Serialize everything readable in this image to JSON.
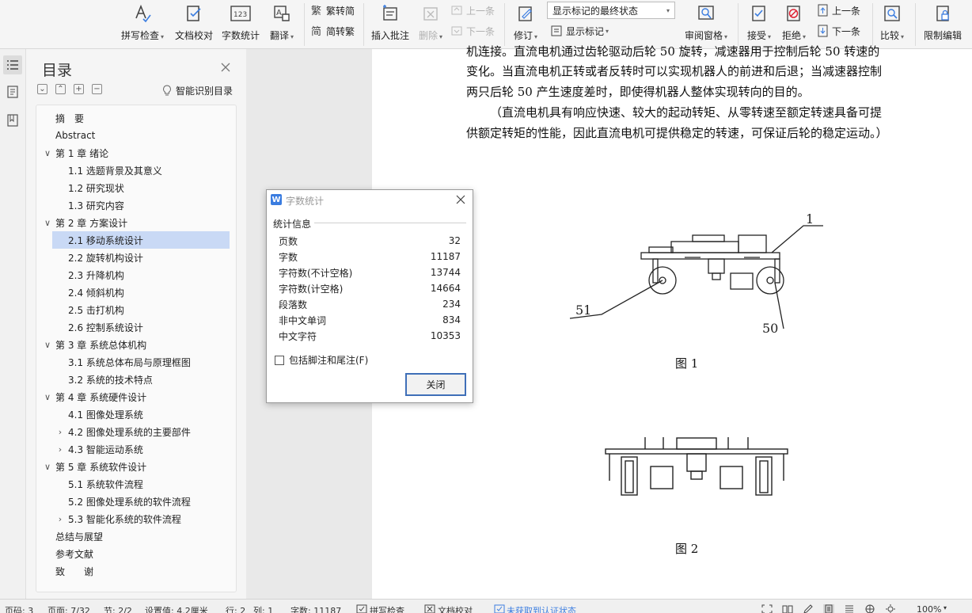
{
  "ribbon": {
    "spell_check": "拼写检查",
    "doc_proof": "文档校对",
    "word_count": "字数统计",
    "translate": "翻译",
    "trad_to_simp": "繁转简",
    "simp_to_trad": "简转繁",
    "insert_comment": "插入批注",
    "delete": "删除",
    "prev_comment": "上一条",
    "next_comment": "下一条",
    "revise": "修订",
    "markup_mode": "显示标记的最终状态",
    "show_markup": "显示标记",
    "review_pane": "审阅窗格",
    "accept": "接受",
    "reject": "拒绝",
    "prev_change": "上一条",
    "next_change": "下一条",
    "compare": "比较",
    "restrict_edit": "限制编辑"
  },
  "toc": {
    "title": "目录",
    "smart_label": "智能识别目录",
    "items": [
      {
        "label": "摘　要",
        "level": 1,
        "chevron": ""
      },
      {
        "label": "Abstract",
        "level": 1,
        "chevron": ""
      },
      {
        "label": "第 1 章  绪论",
        "level": 1,
        "chevron": "∨"
      },
      {
        "label": "1.1 选题背景及其意义",
        "level": 2,
        "chevron": ""
      },
      {
        "label": "1.2 研究现状",
        "level": 2,
        "chevron": ""
      },
      {
        "label": "1.3 研究内容",
        "level": 2,
        "chevron": ""
      },
      {
        "label": "第 2 章  方案设计",
        "level": 1,
        "chevron": "∨"
      },
      {
        "label": "2.1  移动系统设计",
        "level": 2,
        "chevron": "",
        "selected": true
      },
      {
        "label": "2.2 旋转机构设计",
        "level": 2,
        "chevron": ""
      },
      {
        "label": "2.3 升降机构",
        "level": 2,
        "chevron": ""
      },
      {
        "label": "2.4 倾斜机构",
        "level": 2,
        "chevron": ""
      },
      {
        "label": "2.5 击打机构",
        "level": 2,
        "chevron": ""
      },
      {
        "label": "2.6 控制系统设计",
        "level": 2,
        "chevron": ""
      },
      {
        "label": "第 3 章  系统总体机构",
        "level": 1,
        "chevron": "∨"
      },
      {
        "label": "3.1 系统总体布局与原理框图",
        "level": 2,
        "chevron": ""
      },
      {
        "label": "3.2 系统的技术特点",
        "level": 2,
        "chevron": ""
      },
      {
        "label": "第 4 章  系统硬件设计",
        "level": 1,
        "chevron": "∨"
      },
      {
        "label": "4.1 图像处理系统",
        "level": 2,
        "chevron": ""
      },
      {
        "label": "4.2  图像处理系统的主要部件",
        "level": 2,
        "chevron": "›"
      },
      {
        "label": "4.3 智能运动系统",
        "level": 2,
        "chevron": "›"
      },
      {
        "label": "第 5 章  系统软件设计",
        "level": 1,
        "chevron": "∨"
      },
      {
        "label": "5.1 系统软件流程",
        "level": 2,
        "chevron": ""
      },
      {
        "label": "5.2 图像处理系统的软件流程",
        "level": 2,
        "chevron": ""
      },
      {
        "label": "5.3 智能化系统的软件流程",
        "level": 2,
        "chevron": "›"
      },
      {
        "label": "总结与展望",
        "level": 1,
        "chevron": ""
      },
      {
        "label": "参考文献",
        "level": 1,
        "chevron": ""
      },
      {
        "label": "致　　谢",
        "level": 1,
        "chevron": ""
      }
    ]
  },
  "document": {
    "line0": "机连接。直流电机通过齿轮驱动后轮 50 旋转，减速器用于控制后轮 50 转速的",
    "line1": "变化。当直流电机正转或者反转时可以实现机器人的前进和后退；当减速器控制",
    "line2": "两只后轮 50 产生速度差时，即使得机器人整体实现转向的目的。",
    "line3": "（直流电机具有响应快速、较大的起动转矩、从零转速至额定转速具备可提",
    "line4": "供额定转矩的性能，因此直流电机可提供稳定的转速，可保证后轮的稳定运动。）",
    "fig1_caption": "图 1",
    "fig2_caption": "图 2",
    "fig1_label_1": "1",
    "fig1_label_51": "51",
    "fig1_label_50": "50"
  },
  "dialog": {
    "title": "字数统计",
    "logo": "W",
    "group_label": "统计信息",
    "stats": [
      {
        "label": "页数",
        "value": "32"
      },
      {
        "label": "字数",
        "value": "11187"
      },
      {
        "label": "字符数(不计空格)",
        "value": "13744"
      },
      {
        "label": "字符数(计空格)",
        "value": "14664"
      },
      {
        "label": "段落数",
        "value": "234"
      },
      {
        "label": "非中文单词",
        "value": "834"
      },
      {
        "label": "中文字符",
        "value": "10353"
      }
    ],
    "include_footnotes": "包括脚注和尾注(F)",
    "close_button": "关闭"
  },
  "status": {
    "page_code": "页码: 3",
    "page": "页面: 7/32",
    "section": "节: 2/2",
    "setting": "设置值: 4.2厘米",
    "row": "行: 2",
    "col": "列: 1",
    "word_count": "字数: 11187",
    "spell_check": "拼写检查",
    "doc_proof": "文档校对",
    "cert": "未获取到认证状态",
    "zoom": "100%"
  },
  "colors": {
    "accent": "#3b7de0",
    "selection": "#c9d9f5",
    "button_border": "#3f6fb8"
  }
}
